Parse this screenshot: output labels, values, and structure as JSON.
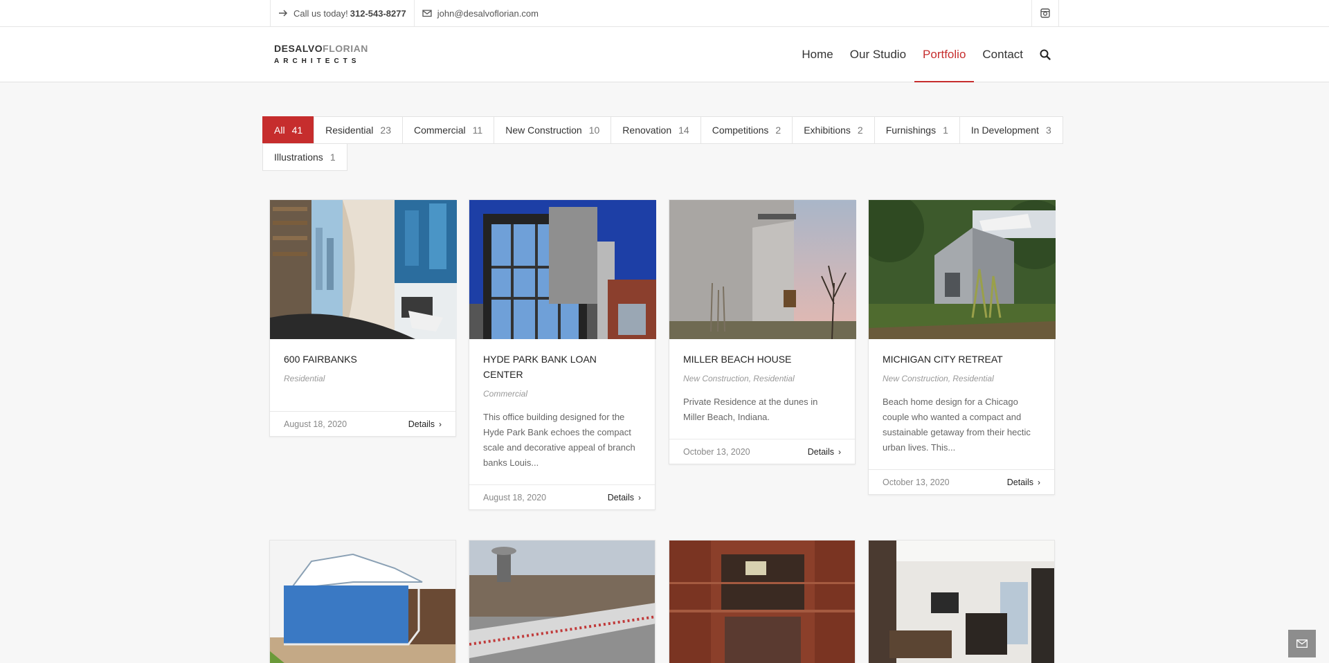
{
  "topbar": {
    "call_prefix": "Call us today!",
    "phone": "312-543-8277",
    "email": "john@desalvoflorian.com",
    "social_icon": "instagram-icon"
  },
  "logo": {
    "line1_a": "DESALVO",
    "line1_b": "FLORIAN",
    "line2": "ARCHITECTS"
  },
  "nav": {
    "items": [
      {
        "label": "Home"
      },
      {
        "label": "Our Studio"
      },
      {
        "label": "Portfolio",
        "active": true
      },
      {
        "label": "Contact"
      }
    ],
    "search_icon": "search-icon",
    "accent_color": "#c62d2d"
  },
  "filters": [
    {
      "label": "All",
      "count": "41",
      "active": true
    },
    {
      "label": "Residential",
      "count": "23"
    },
    {
      "label": "Commercial",
      "count": "11"
    },
    {
      "label": "New Construction",
      "count": "10"
    },
    {
      "label": "Renovation",
      "count": "14"
    },
    {
      "label": "Competitions",
      "count": "2"
    },
    {
      "label": "Exhibitions",
      "count": "2"
    },
    {
      "label": "Furnishings",
      "count": "1"
    },
    {
      "label": "In Development",
      "count": "3"
    },
    {
      "label": "Illustrations",
      "count": "1"
    }
  ],
  "projects": [
    {
      "title": "600 FAIRBANKS",
      "cats": "Residential",
      "excerpt": "",
      "date": "August 18, 2020",
      "details": "Details"
    },
    {
      "title": "HYDE PARK BANK LOAN CENTER",
      "cats": "Commercial",
      "excerpt": "This office building designed for the Hyde Park Bank echoes the compact scale and decorative appeal of branch banks Louis...",
      "date": "August 18, 2020",
      "details": "Details"
    },
    {
      "title": "MILLER BEACH HOUSE",
      "cats": "New Construction, Residential",
      "excerpt": "Private Residence at the dunes in Miller Beach, Indiana.",
      "date": "October 13, 2020",
      "details": "Details"
    },
    {
      "title": "MICHIGAN CITY RETREAT",
      "cats": "New Construction, Residential",
      "excerpt": "Beach home design for a Chicago couple who wanted a compact and sustainable getaway from their hectic urban lives. This...",
      "date": "October 13, 2020",
      "details": "Details"
    }
  ],
  "float_button_icon": "mail-icon"
}
